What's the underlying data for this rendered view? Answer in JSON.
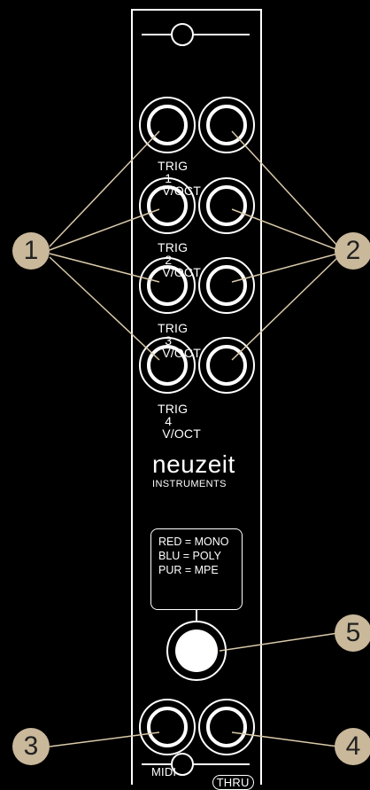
{
  "panel": {
    "brand": "neuzeit",
    "brand_sub": "INSTRUMENTS",
    "jack_rows": [
      {
        "left": "TRIG",
        "number": "1",
        "right": "V/OCT"
      },
      {
        "left": "TRIG",
        "number": "2",
        "right": "V/OCT"
      },
      {
        "left": "TRIG",
        "number": "3",
        "right": "V/OCT"
      },
      {
        "left": "TRIG",
        "number": "4",
        "right": "V/OCT"
      }
    ],
    "legend": [
      "RED = MONO",
      "BLU = POLY",
      "PUR = MPE"
    ],
    "midi_label": "MIDI",
    "thru_label": "THRU"
  },
  "callouts": [
    "1",
    "2",
    "3",
    "4",
    "5"
  ],
  "colors": {
    "background": "#000000",
    "line": "#ffffff",
    "callout_fill": "#c9b89a",
    "callout_text": "#222222",
    "leader_line": "#d9c9a9"
  }
}
